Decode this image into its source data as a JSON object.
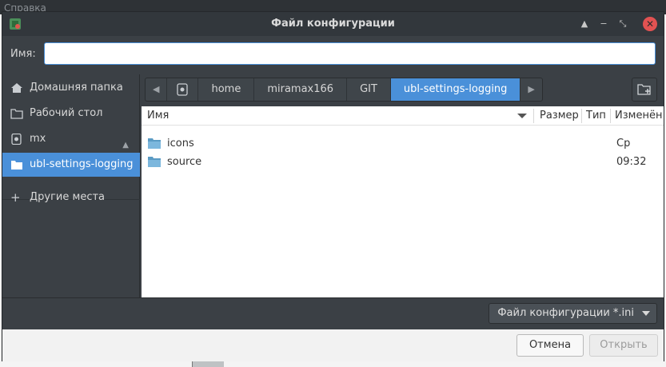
{
  "background_app": {
    "menu_label": "Справка"
  },
  "dialog": {
    "title": "Файл конфигурации",
    "name_label": "Имя:",
    "name_value": ""
  },
  "sidebar": {
    "items": [
      {
        "label": "Домашняя папка",
        "icon": "home-icon"
      },
      {
        "label": "Рабочий стол",
        "icon": "folder-icon"
      },
      {
        "label": "mx",
        "icon": "drive-icon"
      },
      {
        "label": "ubl-settings-logging",
        "icon": "folder-icon",
        "active": true
      },
      {
        "label": "Другие места",
        "icon": "plus-icon"
      }
    ]
  },
  "pathbar": {
    "segments": [
      "home",
      "miramax166",
      "GIT",
      "ubl-settings-logging"
    ]
  },
  "filelist": {
    "columns": [
      "Имя",
      "Размер",
      "Тип",
      "Изменён"
    ],
    "rows": [
      {
        "name": "icons",
        "modified": "Ср"
      },
      {
        "name": "source",
        "modified": "09:32"
      }
    ]
  },
  "footer": {
    "filter_label": "Файл конфигурации *.ini",
    "cancel_label": "Отмена",
    "open_label": "Открыть"
  },
  "colors": {
    "accent": "#4a90d9",
    "dark_bg": "#3b4045",
    "close": "#e25252"
  }
}
